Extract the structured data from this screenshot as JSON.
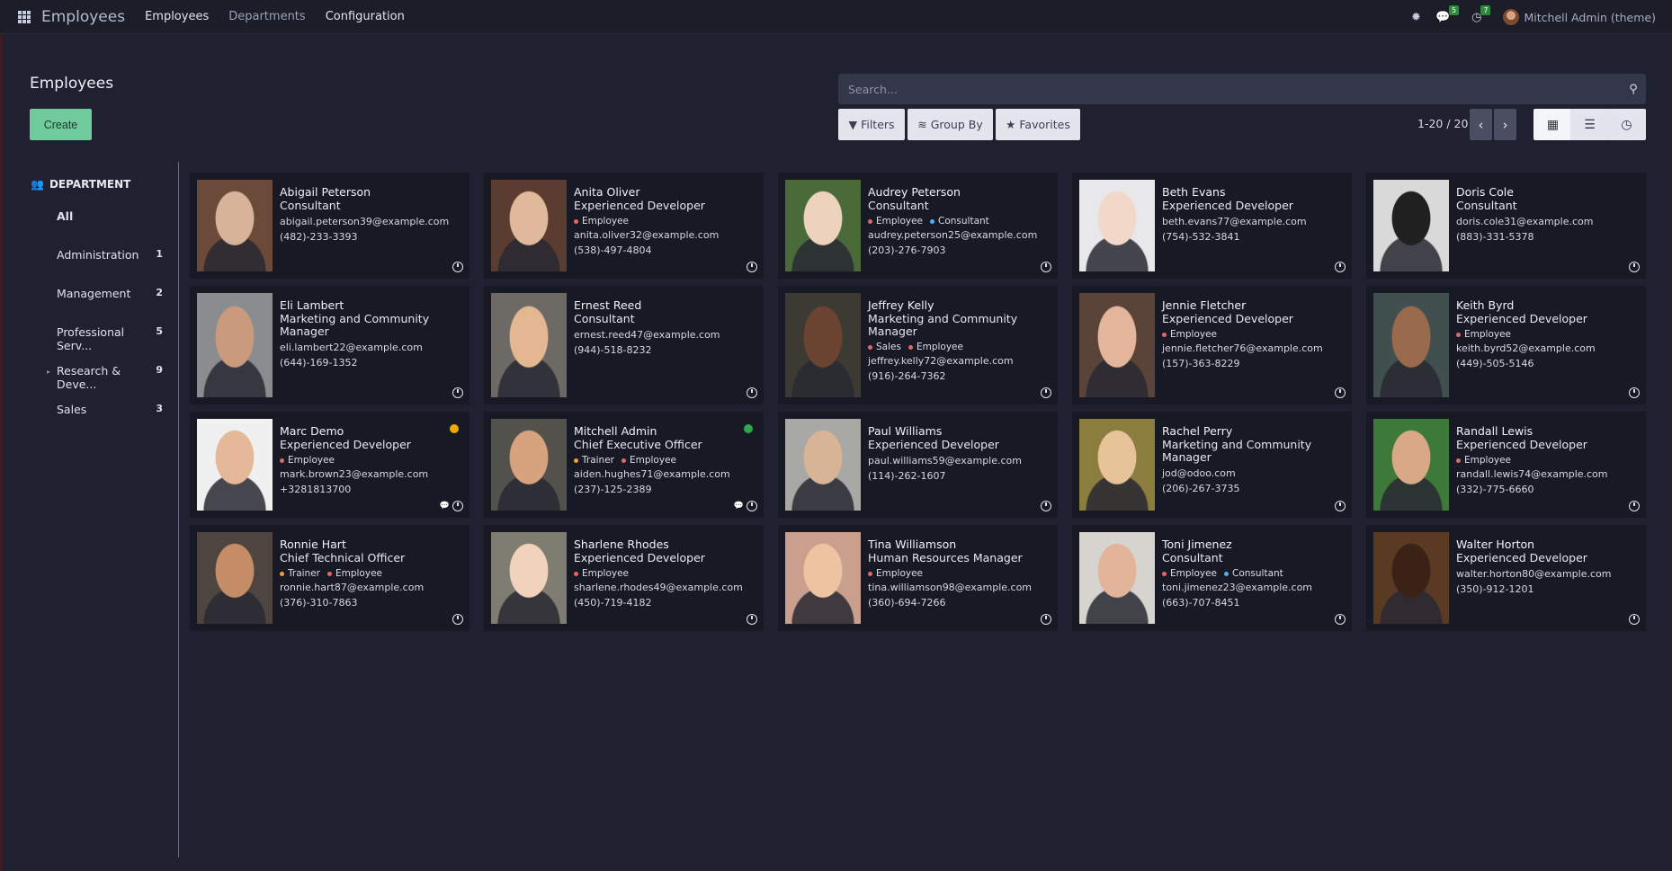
{
  "topbar": {
    "app_title": "Employees",
    "menu": [
      "Employees",
      "Departments",
      "Configuration"
    ],
    "messages_count": "5",
    "activities_count": "7",
    "user_name": "Mitchell Admin (theme)"
  },
  "control_panel": {
    "title": "Employees",
    "create_label": "Create",
    "search_placeholder": "Search...",
    "filters_label": "Filters",
    "groupby_label": "Group By",
    "favorites_label": "Favorites",
    "pager": "1-20 / 20"
  },
  "sidepanel": {
    "header": "DEPARTMENT",
    "items": [
      {
        "label": "All",
        "count": ""
      },
      {
        "label": "Administration",
        "count": "1"
      },
      {
        "label": "Management",
        "count": "2"
      },
      {
        "label": "Professional Serv...",
        "count": "5"
      },
      {
        "label": "Research & Deve...",
        "count": "9"
      },
      {
        "label": "Sales",
        "count": "3"
      }
    ]
  },
  "colors": {
    "accent": "#6fca9c",
    "tag_red": "#e06a6a",
    "tag_blue": "#4fb0e6",
    "tag_orange": "#f0a040",
    "online": "#2ea84a",
    "away": "#f0a800"
  },
  "employees": [
    {
      "name": "Abigail Peterson",
      "job": "Consultant",
      "email": "abigail.peterson39@example.com",
      "phone": "(482)-233-3393",
      "tags": []
    },
    {
      "name": "Anita Oliver",
      "job": "Experienced Developer",
      "email": "anita.oliver32@example.com",
      "phone": "(538)-497-4804",
      "tags": [
        "Employee"
      ]
    },
    {
      "name": "Audrey Peterson",
      "job": "Consultant",
      "email": "audrey.peterson25@example.com",
      "phone": "(203)-276-7903",
      "tags": [
        "Employee",
        "Consultant"
      ]
    },
    {
      "name": "Beth Evans",
      "job": "Experienced Developer",
      "email": "beth.evans77@example.com",
      "phone": "(754)-532-3841",
      "tags": []
    },
    {
      "name": "Doris Cole",
      "job": "Consultant",
      "email": "doris.cole31@example.com",
      "phone": "(883)-331-5378",
      "tags": []
    },
    {
      "name": "Eli Lambert",
      "job": "Marketing and Community Manager",
      "email": "eli.lambert22@example.com",
      "phone": "(644)-169-1352",
      "tags": []
    },
    {
      "name": "Ernest Reed",
      "job": "Consultant",
      "email": "ernest.reed47@example.com",
      "phone": "(944)-518-8232",
      "tags": []
    },
    {
      "name": "Jeffrey Kelly",
      "job": "Marketing and Community Manager",
      "email": "jeffrey.kelly72@example.com",
      "phone": "(916)-264-7362",
      "tags": [
        "Sales",
        "Employee"
      ]
    },
    {
      "name": "Jennie Fletcher",
      "job": "Experienced Developer",
      "email": "jennie.fletcher76@example.com",
      "phone": "(157)-363-8229",
      "tags": [
        "Employee"
      ]
    },
    {
      "name": "Keith Byrd",
      "job": "Experienced Developer",
      "email": "keith.byrd52@example.com",
      "phone": "(449)-505-5146",
      "tags": [
        "Employee"
      ]
    },
    {
      "name": "Marc Demo",
      "job": "Experienced Developer",
      "email": "mark.brown23@example.com",
      "phone": "+3281813700",
      "tags": [
        "Employee"
      ]
    },
    {
      "name": "Mitchell Admin",
      "job": "Chief Executive Officer",
      "email": "aiden.hughes71@example.com",
      "phone": "(237)-125-2389",
      "tags": [
        "Trainer",
        "Employee"
      ]
    },
    {
      "name": "Paul Williams",
      "job": "Experienced Developer",
      "email": "paul.williams59@example.com",
      "phone": "(114)-262-1607",
      "tags": []
    },
    {
      "name": "Rachel Perry",
      "job": "Marketing and Community Manager",
      "email": "jod@odoo.com",
      "phone": "(206)-267-3735",
      "tags": []
    },
    {
      "name": "Randall Lewis",
      "job": "Experienced Developer",
      "email": "randall.lewis74@example.com",
      "phone": "(332)-775-6660",
      "tags": [
        "Employee"
      ]
    },
    {
      "name": "Ronnie Hart",
      "job": "Chief Technical Officer",
      "email": "ronnie.hart87@example.com",
      "phone": "(376)-310-7863",
      "tags": [
        "Trainer",
        "Employee"
      ]
    },
    {
      "name": "Sharlene Rhodes",
      "job": "Experienced Developer",
      "email": "sharlene.rhodes49@example.com",
      "phone": "(450)-719-4182",
      "tags": [
        "Employee"
      ]
    },
    {
      "name": "Tina Williamson",
      "job": "Human Resources Manager",
      "email": "tina.williamson98@example.com",
      "phone": "(360)-694-7266",
      "tags": [
        "Employee"
      ]
    },
    {
      "name": "Toni Jimenez",
      "job": "Consultant",
      "email": "toni.jimenez23@example.com",
      "phone": "(663)-707-8451",
      "tags": [
        "Employee",
        "Consultant"
      ]
    },
    {
      "name": "Walter Horton",
      "job": "Experienced Developer",
      "email": "walter.horton80@example.com",
      "phone": "(350)-912-1201",
      "tags": []
    }
  ]
}
